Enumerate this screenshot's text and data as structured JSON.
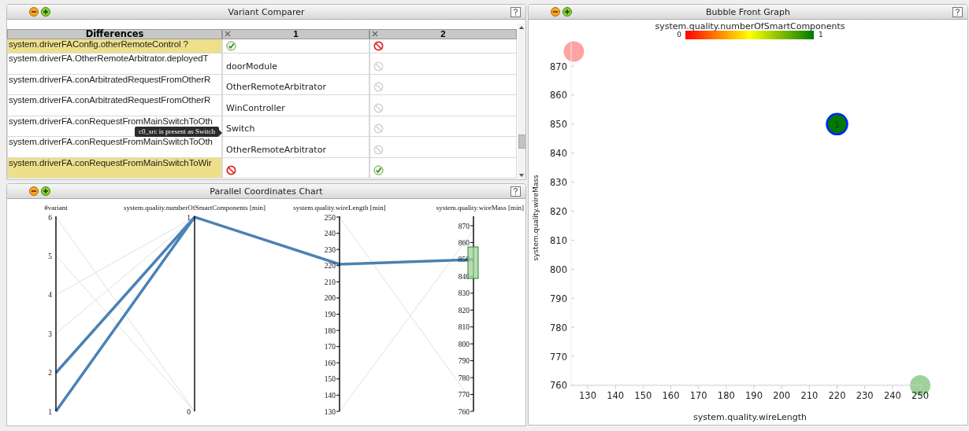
{
  "variant_comparer": {
    "title": "Variant Comparer",
    "columns": [
      {
        "label": "Differences",
        "closable": false
      },
      {
        "label": "1",
        "closable": true
      },
      {
        "label": "2",
        "closable": true
      }
    ],
    "rows": [
      {
        "name": "system.driverFAConfig.otherRemoteControl ?",
        "highlighted": true,
        "cells": [
          {
            "kind": "check"
          },
          {
            "kind": "forbidden"
          }
        ]
      },
      {
        "name": "system.driverFA.OtherRemoteArbitrator.deployedT",
        "highlighted": false,
        "cells": [
          {
            "kind": "text",
            "text": "doorModule"
          },
          {
            "kind": "absent"
          }
        ]
      },
      {
        "name": "system.driverFA.conArbitratedRequestFromOtherR",
        "highlighted": false,
        "cells": [
          {
            "kind": "text",
            "text": "OtherRemoteArbitrator"
          },
          {
            "kind": "absent"
          }
        ]
      },
      {
        "name": "system.driverFA.conArbitratedRequestFromOtherR",
        "highlighted": false,
        "cells": [
          {
            "kind": "text",
            "text": "WinController"
          },
          {
            "kind": "absent"
          }
        ]
      },
      {
        "name": "system.driverFA.conRequestFromMainSwitchToOth",
        "highlighted": false,
        "cells": [
          {
            "kind": "text",
            "text": "Switch",
            "tooltip": "c0_src is present as Switch"
          },
          {
            "kind": "absent"
          }
        ]
      },
      {
        "name": "system.driverFA.conRequestFromMainSwitchToOth",
        "highlighted": false,
        "cells": [
          {
            "kind": "text",
            "text": "OtherRemoteArbitrator"
          },
          {
            "kind": "absent"
          }
        ]
      },
      {
        "name": "system.driverFA.conRequestFromMainSwitchToWir",
        "highlighted": true,
        "cells": [
          {
            "kind": "forbidden"
          },
          {
            "kind": "check"
          }
        ]
      }
    ]
  },
  "parallel_chart": {
    "title": "Parallel Coordinates Chart",
    "axes": [
      {
        "title": "#variant",
        "ticks": [
          "6",
          "5",
          "4",
          "3",
          "2",
          "1"
        ],
        "tick_marks": false
      },
      {
        "title": "system.quality.numberOfSmartComponents [min]",
        "ticks": [
          "1",
          "0"
        ],
        "tick_marks": false
      },
      {
        "title": "system.quality.wireLength [min]",
        "ticks": [
          "250",
          "240",
          "230",
          "220",
          "210",
          "200",
          "190",
          "180",
          "170",
          "160",
          "150",
          "140",
          "130"
        ],
        "tick_marks": true
      },
      {
        "title": "system.quality.wireMass [min]",
        "ticks": [
          "870",
          "860",
          "850",
          "840",
          "830",
          "820",
          "810",
          "800",
          "790",
          "780",
          "770",
          "760"
        ],
        "tick_marks": true
      }
    ]
  },
  "bubble_graph": {
    "title": "Bubble Front Graph",
    "legend": {
      "title": "system.quality.numberOfSmartComponents",
      "min": "0",
      "max": "1"
    },
    "chart_data": {
      "type": "scatter",
      "xlabel": "system.quality.wireLength",
      "ylabel": "system.quality.wireMass",
      "xlim": [
        124,
        250.8
      ],
      "ylim": [
        760,
        878
      ],
      "xticks": [
        130,
        140,
        150,
        160,
        170,
        180,
        190,
        200,
        210,
        220,
        230,
        240,
        250
      ],
      "yticks": [
        760,
        770,
        780,
        790,
        800,
        810,
        820,
        830,
        840,
        850,
        860,
        870
      ],
      "series": [
        {
          "color": "#ffa3a3",
          "x": [
            125
          ],
          "values": [
            875
          ]
        },
        {
          "color": "#007a00",
          "x": [
            220
          ],
          "values": [
            850
          ]
        },
        {
          "color": "#9dd29a",
          "x": [
            250
          ],
          "values": [
            760
          ]
        }
      ],
      "annotations": [
        {
          "x": 220,
          "y": 850,
          "text": "1"
        }
      ]
    }
  }
}
